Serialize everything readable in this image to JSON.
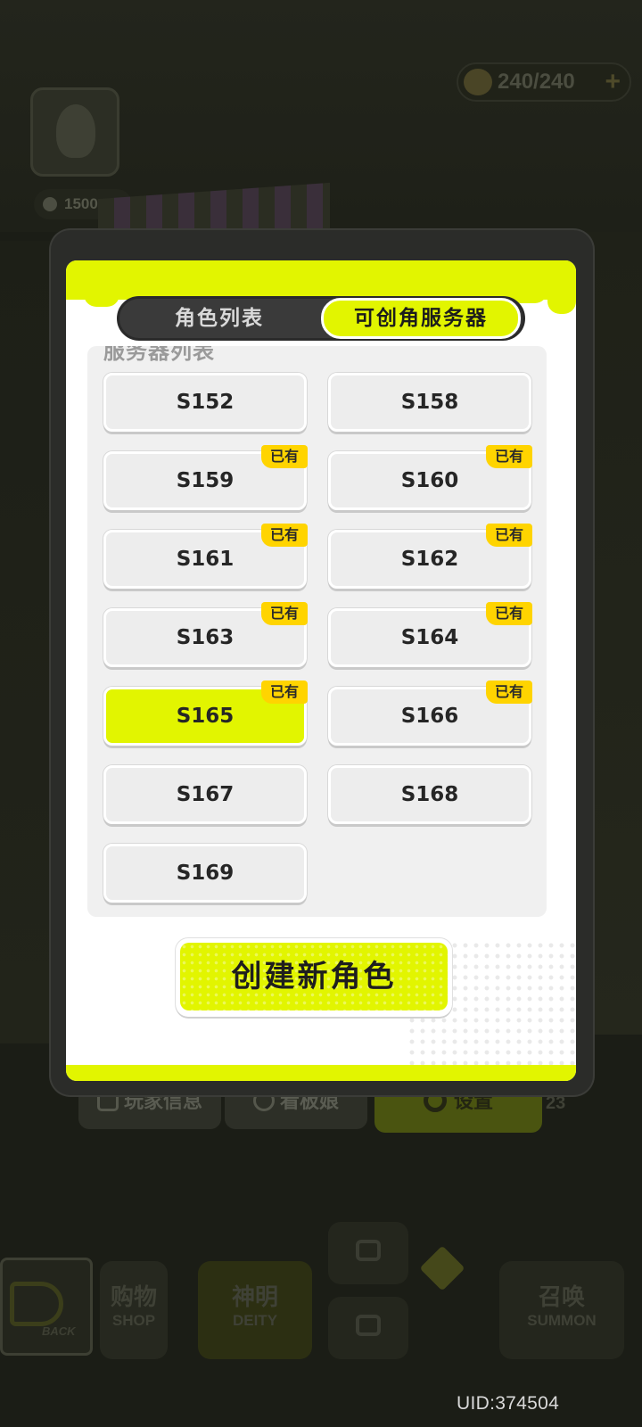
{
  "background": {
    "energy": "240/240",
    "power": "1500",
    "buttons": {
      "player_info": "玩家信息",
      "mascot": "看板娘",
      "settings": "设置",
      "side_number": "23"
    },
    "nav": {
      "back": "BACK",
      "shop_zh": "购物",
      "shop_en": "SHOP",
      "deity_zh": "神明",
      "deity_en": "DEITY",
      "summon_zh": "召唤",
      "summon_en": "SUMMON"
    },
    "uid": "UID:374504"
  },
  "modal": {
    "tabs": [
      {
        "label": "角色列表",
        "active": false
      },
      {
        "label": "可创角服务器",
        "active": true
      }
    ],
    "list_title": "服务器列表",
    "badge_label": "已有",
    "servers": [
      {
        "name": "S152",
        "owned": false,
        "selected": false
      },
      {
        "name": "S158",
        "owned": false,
        "selected": false
      },
      {
        "name": "S159",
        "owned": true,
        "selected": false
      },
      {
        "name": "S160",
        "owned": true,
        "selected": false
      },
      {
        "name": "S161",
        "owned": true,
        "selected": false
      },
      {
        "name": "S162",
        "owned": true,
        "selected": false
      },
      {
        "name": "S163",
        "owned": true,
        "selected": false
      },
      {
        "name": "S164",
        "owned": true,
        "selected": false
      },
      {
        "name": "S165",
        "owned": true,
        "selected": true
      },
      {
        "name": "S166",
        "owned": true,
        "selected": false
      },
      {
        "name": "S167",
        "owned": false,
        "selected": false
      },
      {
        "name": "S168",
        "owned": false,
        "selected": false
      },
      {
        "name": "S169",
        "owned": false,
        "selected": false
      }
    ],
    "create_button": "创建新角色"
  },
  "colors": {
    "accent_yellow_green": "#e2f500",
    "badge_yellow": "#ffd400"
  }
}
